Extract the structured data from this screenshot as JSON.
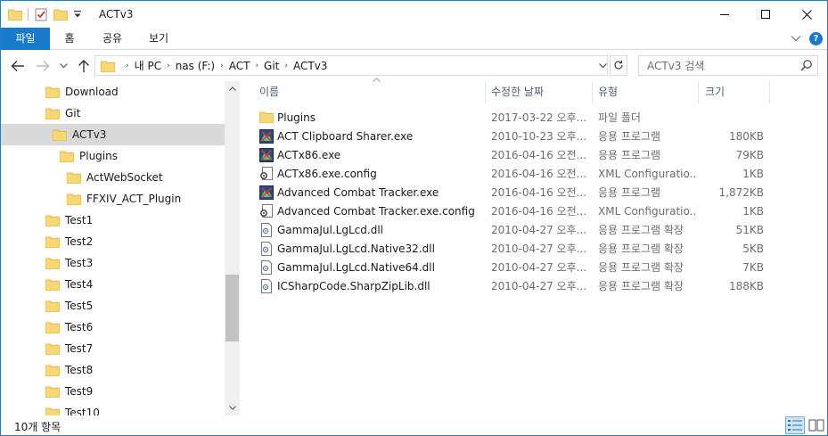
{
  "window": {
    "title": "ACTv3"
  },
  "ribbon": {
    "tabs": [
      "파일",
      "홈",
      "공유",
      "보기"
    ]
  },
  "address": {
    "crumbs": [
      "내 PC",
      "nas (F:)",
      "ACT",
      "Git",
      "ACTv3"
    ]
  },
  "search": {
    "placeholder": "ACTv3 검색"
  },
  "tree": [
    {
      "label": "Download",
      "indent": 0,
      "selected": false
    },
    {
      "label": "Git",
      "indent": 0,
      "selected": false
    },
    {
      "label": "ACTv3",
      "indent": 1,
      "selected": true
    },
    {
      "label": "Plugins",
      "indent": 2,
      "selected": false
    },
    {
      "label": "ActWebSocket",
      "indent": 3,
      "selected": false
    },
    {
      "label": "FFXIV_ACT_Plugin",
      "indent": 3,
      "selected": false
    },
    {
      "label": "Test1",
      "indent": 0,
      "selected": false
    },
    {
      "label": "Test2",
      "indent": 0,
      "selected": false
    },
    {
      "label": "Test3",
      "indent": 0,
      "selected": false
    },
    {
      "label": "Test4",
      "indent": 0,
      "selected": false
    },
    {
      "label": "Test5",
      "indent": 0,
      "selected": false
    },
    {
      "label": "Test6",
      "indent": 0,
      "selected": false
    },
    {
      "label": "Test7",
      "indent": 0,
      "selected": false
    },
    {
      "label": "Test8",
      "indent": 0,
      "selected": false
    },
    {
      "label": "Test9",
      "indent": 0,
      "selected": false
    },
    {
      "label": "Test10",
      "indent": 0,
      "selected": false
    }
  ],
  "columns": {
    "name": "이름",
    "date": "수정한 날짜",
    "type": "유형",
    "size": "크기"
  },
  "files": [
    {
      "name": "Plugins",
      "date": "2017-03-22 오후...",
      "type": "파일 폴더",
      "size": "",
      "icon": "folder-icon"
    },
    {
      "name": "ACT Clipboard Sharer.exe",
      "date": "2010-10-23 오후...",
      "type": "응용 프로그램",
      "size": "180KB",
      "icon": "app-icon"
    },
    {
      "name": "ACTx86.exe",
      "date": "2016-04-16 오전...",
      "type": "응용 프로그램",
      "size": "79KB",
      "icon": "app-icon"
    },
    {
      "name": "ACTx86.exe.config",
      "date": "2016-04-16 오전...",
      "type": "XML Configuratio...",
      "size": "1KB",
      "icon": "config-icon"
    },
    {
      "name": "Advanced Combat Tracker.exe",
      "date": "2016-04-16 오전...",
      "type": "응용 프로그램",
      "size": "1,872KB",
      "icon": "app-icon"
    },
    {
      "name": "Advanced Combat Tracker.exe.config",
      "date": "2016-04-16 오전...",
      "type": "XML Configuratio...",
      "size": "1KB",
      "icon": "config-icon"
    },
    {
      "name": "GammaJul.LgLcd.dll",
      "date": "2010-04-27 오후...",
      "type": "응용 프로그램 확장",
      "size": "51KB",
      "icon": "dll-icon"
    },
    {
      "name": "GammaJul.LgLcd.Native32.dll",
      "date": "2010-04-27 오후...",
      "type": "응용 프로그램 확장",
      "size": "5KB",
      "icon": "dll-icon"
    },
    {
      "name": "GammaJul.LgLcd.Native64.dll",
      "date": "2010-04-27 오후...",
      "type": "응용 프로그램 확장",
      "size": "7KB",
      "icon": "dll-icon"
    },
    {
      "name": "ICSharpCode.SharpZipLib.dll",
      "date": "2010-04-27 오후...",
      "type": "응용 프로그램 확장",
      "size": "188KB",
      "icon": "dll-icon"
    }
  ],
  "status": {
    "item_count": "10개 항목"
  },
  "colors": {
    "accent": "#1979ca",
    "folder": "#f8d775",
    "selection": "#d9d9d9"
  }
}
